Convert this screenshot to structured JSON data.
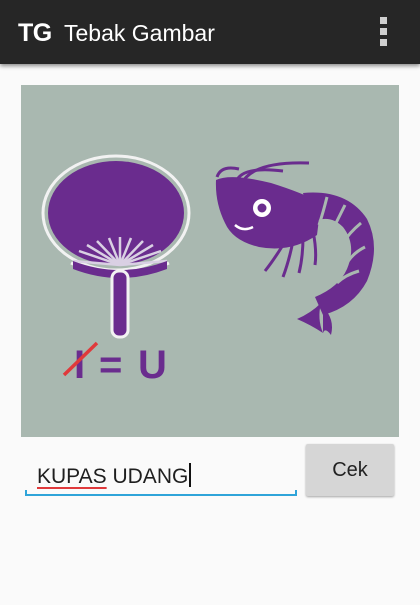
{
  "app_bar": {
    "logo_text": "TG",
    "title": "Tebak Gambar",
    "overflow_icon": "more-vert-icon",
    "background": "#262626"
  },
  "puzzle": {
    "image_icons": [
      "hand-fan-icon",
      "shrimp-icon"
    ],
    "hint_letters": {
      "crossed_letter": "I",
      "equals": "=",
      "replacement_letter": "U"
    },
    "background": "#a9b8b0",
    "figure_color": "#6a2c8e"
  },
  "answer": {
    "value": "KUPAS UDANG",
    "first_word": "KUPAS",
    "rest": " UDANG",
    "accent_color": "#2fa4d9"
  },
  "check_button": {
    "label": "Cek"
  }
}
